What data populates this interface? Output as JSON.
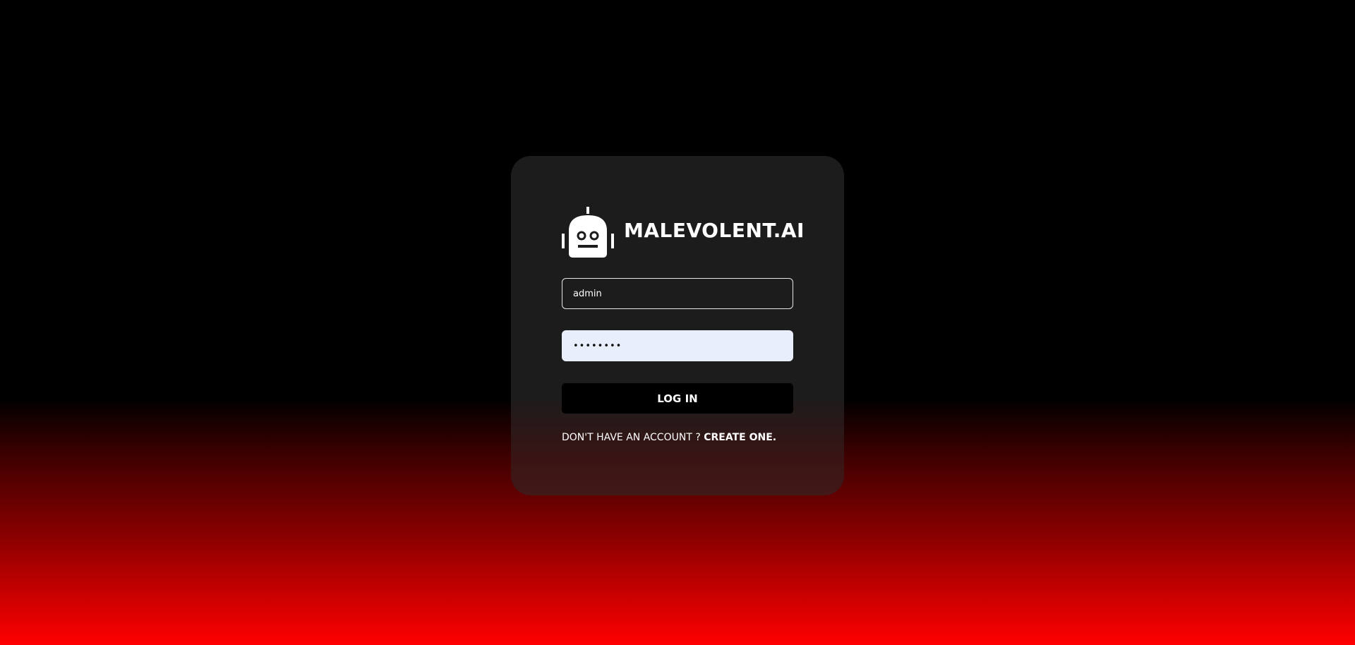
{
  "brand": {
    "name": "MALEVOLENT.AI",
    "logo_icon": "robot-icon"
  },
  "form": {
    "username_value": "admin",
    "password_value": "••••••••",
    "login_label": "LOG IN"
  },
  "signup": {
    "prompt": "DON'T HAVE AN ACCOUNT ?",
    "link_label": "CREATE ONE."
  },
  "colors": {
    "card_background": "#1c1c1c",
    "password_field_background": "#e8eefc",
    "button_background": "#000000",
    "gradient_bottom": "#ff0000"
  }
}
